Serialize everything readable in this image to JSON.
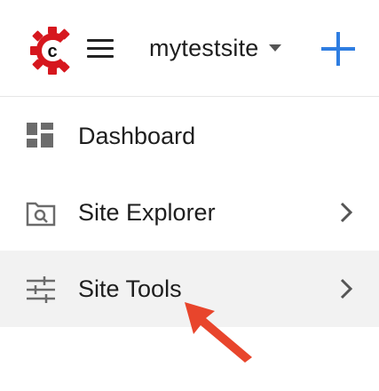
{
  "header": {
    "site_name": "mytestsite",
    "logo_icon": "crafter-logo-icon",
    "menu_icon": "hamburger-menu-icon",
    "dropdown_icon": "caret-down-icon",
    "add_icon": "plus-icon"
  },
  "nav": {
    "items": [
      {
        "label": "Dashboard",
        "icon": "dashboard-icon",
        "has_submenu": false
      },
      {
        "label": "Site Explorer",
        "icon": "site-explorer-icon",
        "has_submenu": true
      },
      {
        "label": "Site Tools",
        "icon": "site-tools-icon",
        "has_submenu": true,
        "highlighted": true
      }
    ]
  },
  "annotation": {
    "icon": "arrow-pointer-icon",
    "color": "#e8452c"
  },
  "colors": {
    "logo_red": "#d6171e",
    "accent_blue": "#2e7de1",
    "icon_gray": "#6b6b6b",
    "highlight_bg": "#f2f2f2"
  }
}
